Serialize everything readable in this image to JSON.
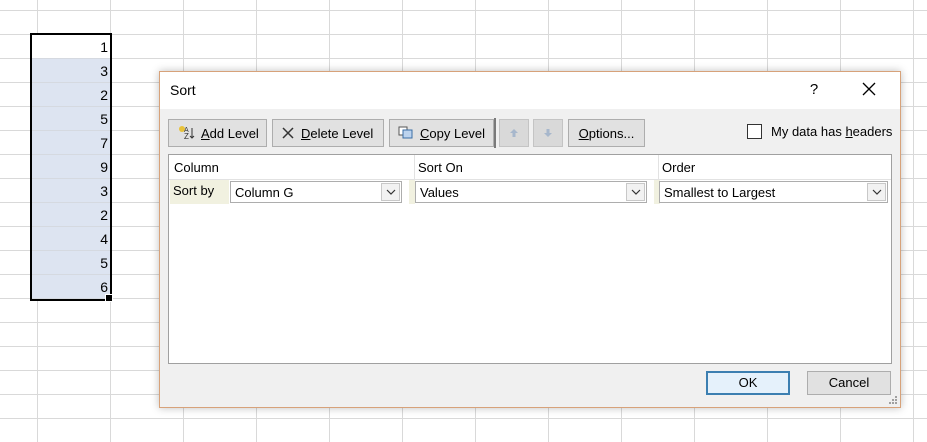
{
  "sheet": {
    "values": [
      "1",
      "3",
      "2",
      "5",
      "7",
      "9",
      "3",
      "2",
      "4",
      "5",
      "6"
    ]
  },
  "dialog": {
    "title": "Sort",
    "help": "?",
    "toolbar": {
      "add_level_prefix": "",
      "add_level_hot": "A",
      "add_level_rest": "dd Level",
      "delete_level_prefix": "",
      "delete_level_hot": "D",
      "delete_level_rest": "elete Level",
      "copy_level_hot": "C",
      "copy_level_rest": "opy Level",
      "options_hot": "O",
      "options_rest": "ptions..."
    },
    "headers_checkbox": {
      "label_prefix": "My data has ",
      "label_hot": "h",
      "label_rest": "eaders",
      "checked": false
    },
    "columns": {
      "column": "Column",
      "sort_on": "Sort On",
      "order": "Order"
    },
    "rows": [
      {
        "label": "Sort by",
        "column": "Column G",
        "sort_on": "Values",
        "order": "Smallest to Largest"
      }
    ],
    "ok_label": "OK",
    "cancel_label": "Cancel"
  },
  "colors": {
    "accent": "#3c7fb1",
    "dialog_border": "#d7a27a",
    "selection_fill": "#dde4f1"
  }
}
